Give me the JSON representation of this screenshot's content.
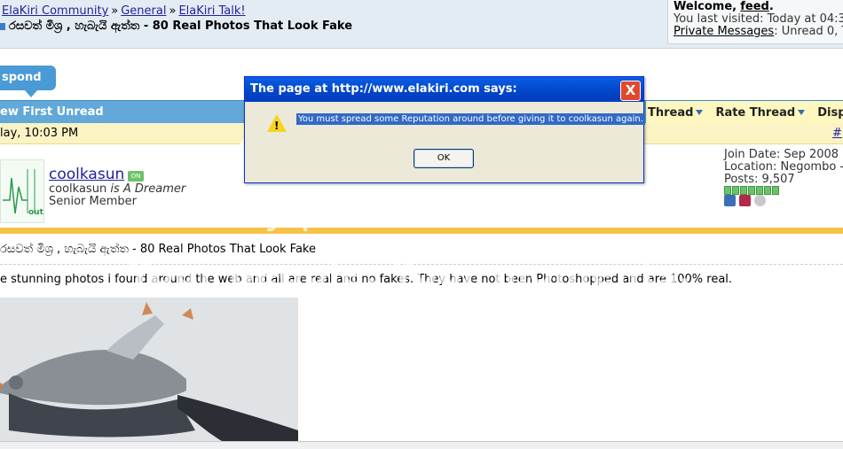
{
  "breadcrumb": {
    "items": [
      "ElaKiri Community",
      "General",
      "ElaKiri Talk!"
    ],
    "separator": "»"
  },
  "thread": {
    "title_top": "රසවත් මිශ්‍ර , හැබැයි ඇත්ත - 80 Real Photos That Look Fake"
  },
  "userbox": {
    "welcome_label": "Welcome,",
    "username": "feed",
    "last_visited": "You last visited: Today at 04:3",
    "pm_label": "Private Messages",
    "pm_status": ": Unread 0, T"
  },
  "actions": {
    "respond_label": "spond"
  },
  "toolbar": {
    "first_unread": "ew First Unread",
    "thread_tools": "Thread",
    "rate_thread": "Rate Thread",
    "display": "Displa"
  },
  "post": {
    "date": "lay, 10:03 PM",
    "number": "#",
    "author": "coolkasun",
    "online_badge": "ON",
    "user_title_name": "coolkasun",
    "user_title_is": "is",
    "user_title_status": "A Dreamer",
    "rank": "Senior Member",
    "join_date": "Join Date: Sep 2008",
    "location": "Location: Negombo -",
    "posts": "Posts: 9,507",
    "avatar_text": "out",
    "title": "රසවත් මිශ්‍ර , හැබැයි ඇත්ත - 80 Real Photos That Look Fake",
    "text": "e stunning photos i found around the web and all are real and no fakes. They have not been Photoshopped and are 100% real."
  },
  "dialog": {
    "title": "The page at http://www.elakiri.com says:",
    "message": "You must spread some Reputation around before giving it to coolkasun again.",
    "ok_label": "OK",
    "close_label": "X"
  },
  "watermark": {
    "brand": "Groupsy",
    "by": "by photobucket",
    "tagline_1": "Your people. Your moments.",
    "tagline_2": "Your space."
  },
  "colors": {
    "toolbar_blue": "#62a8d8",
    "date_bar": "#fbf3c4",
    "gold_separator": "#f7c24a",
    "link": "#22229c"
  }
}
